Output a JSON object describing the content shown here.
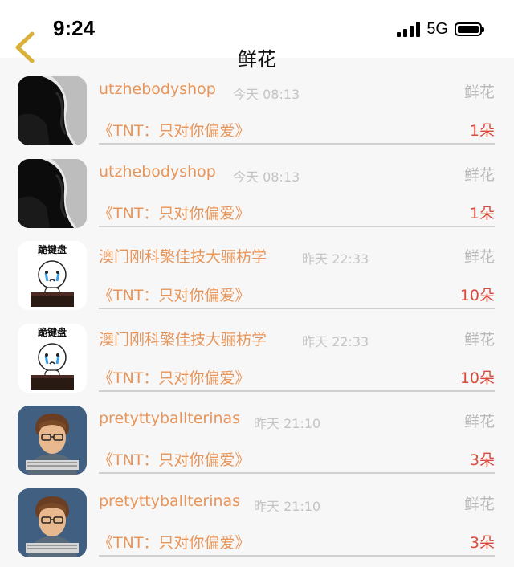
{
  "status": {
    "time": "9:24",
    "network": "5G"
  },
  "nav": {
    "title": "鲜花"
  },
  "items": [
    {
      "avatar": "woman-bw-photo",
      "username": "utzhebodyshop",
      "time": "今天 08:13",
      "gift_type": "鲜花",
      "message": "《TNT：只对你偏爱》",
      "count": "1朵"
    },
    {
      "avatar": "woman-bw-photo",
      "username": "utzhebodyshop",
      "time": "今天 08:13",
      "gift_type": "鲜花",
      "message": "《TNT：只对你偏爱》",
      "count": "1朵"
    },
    {
      "avatar": "kneel-keyboard-cartoon",
      "avatar_text": "跪键盘",
      "username": "澳门刚科檠佳技大骊枋学",
      "time": "昨天 22:33",
      "gift_type": "鲜花",
      "message": "《TNT：只对你偏爱》",
      "count": "10朵"
    },
    {
      "avatar": "kneel-keyboard-cartoon",
      "avatar_text": "跪键盘",
      "username": "澳门刚科檠佳技大骊枋学",
      "time": "昨天 22:33",
      "gift_type": "鲜花",
      "message": "《TNT：只对你偏爱》",
      "count": "10朵"
    },
    {
      "avatar": "boy-glasses-keyboard-photo",
      "username": "pretyttyballterinas",
      "time": "昨天 21:10",
      "gift_type": "鲜花",
      "message": "《TNT：只对你偏爱》",
      "count": "3朵"
    },
    {
      "avatar": "boy-glasses-keyboard-photo",
      "username": "pretyttyballterinas",
      "time": "昨天 21:10",
      "gift_type": "鲜花",
      "message": "《TNT：只对你偏爱》",
      "count": "3朵"
    }
  ],
  "colors": {
    "accent": "#e8955a",
    "count": "#d94a3b",
    "muted": "#c4c4c4",
    "back_arrow": "#d9b13a"
  }
}
